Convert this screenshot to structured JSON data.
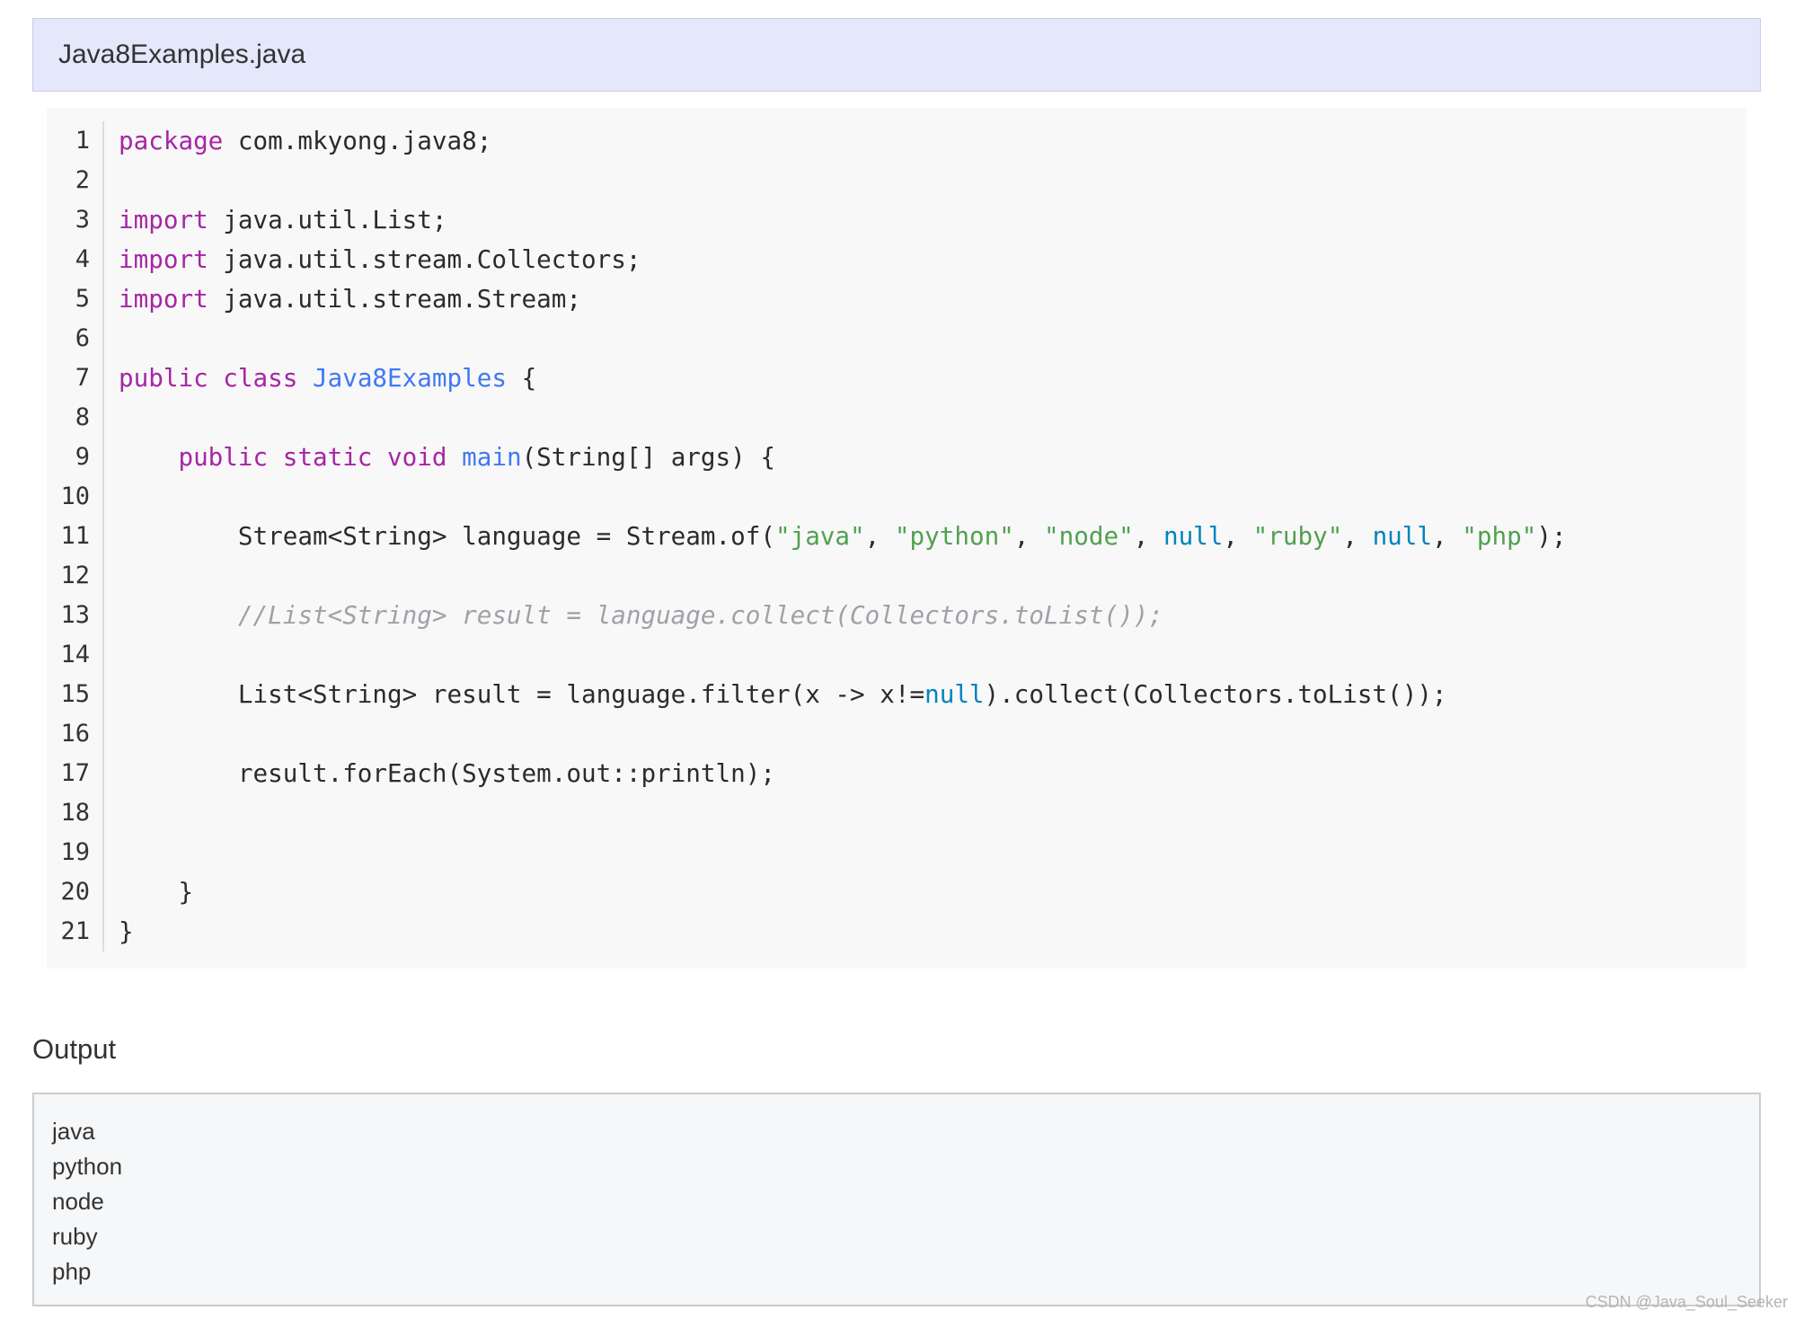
{
  "file_title": "Java8Examples.java",
  "code": {
    "language": "java",
    "line_numbers": [
      "1",
      "2",
      "3",
      "4",
      "5",
      "6",
      "7",
      "8",
      "9",
      "10",
      "11",
      "12",
      "13",
      "14",
      "15",
      "16",
      "17",
      "18",
      "19",
      "20",
      "21"
    ],
    "lines": [
      [
        {
          "t": "kw",
          "v": "package"
        },
        {
          "t": "pl",
          "v": " com.mkyong.java8;"
        }
      ],
      [],
      [
        {
          "t": "kw",
          "v": "import"
        },
        {
          "t": "pl",
          "v": " java.util.List;"
        }
      ],
      [
        {
          "t": "kw",
          "v": "import"
        },
        {
          "t": "pl",
          "v": " java.util.stream.Collectors;"
        }
      ],
      [
        {
          "t": "kw",
          "v": "import"
        },
        {
          "t": "pl",
          "v": " java.util.stream.Stream;"
        }
      ],
      [],
      [
        {
          "t": "kw",
          "v": "public class"
        },
        {
          "t": "pl",
          "v": " "
        },
        {
          "t": "fn",
          "v": "Java8Examples"
        },
        {
          "t": "pl",
          "v": " {"
        }
      ],
      [],
      [
        {
          "t": "pl",
          "v": "    "
        },
        {
          "t": "kw",
          "v": "public static void"
        },
        {
          "t": "pl",
          "v": " "
        },
        {
          "t": "fn",
          "v": "main"
        },
        {
          "t": "pl",
          "v": "(String[] args) {"
        }
      ],
      [],
      [
        {
          "t": "pl",
          "v": "        Stream<String> language = Stream.of("
        },
        {
          "t": "str",
          "v": "\"java\""
        },
        {
          "t": "pl",
          "v": ", "
        },
        {
          "t": "str",
          "v": "\"python\""
        },
        {
          "t": "pl",
          "v": ", "
        },
        {
          "t": "str",
          "v": "\"node\""
        },
        {
          "t": "pl",
          "v": ", "
        },
        {
          "t": "lit",
          "v": "null"
        },
        {
          "t": "pl",
          "v": ", "
        },
        {
          "t": "str",
          "v": "\"ruby\""
        },
        {
          "t": "pl",
          "v": ", "
        },
        {
          "t": "lit",
          "v": "null"
        },
        {
          "t": "pl",
          "v": ", "
        },
        {
          "t": "str",
          "v": "\"php\""
        },
        {
          "t": "pl",
          "v": ");"
        }
      ],
      [],
      [
        {
          "t": "pl",
          "v": "        "
        },
        {
          "t": "cm",
          "v": "//List<String> result = language.collect(Collectors.toList());"
        }
      ],
      [],
      [
        {
          "t": "pl",
          "v": "        List<String> result = language.filter(x -> x!="
        },
        {
          "t": "lit",
          "v": "null"
        },
        {
          "t": "pl",
          "v": ").collect(Collectors.toList());"
        }
      ],
      [],
      [
        {
          "t": "pl",
          "v": "        result.forEach(System.out::println);"
        }
      ],
      [],
      [],
      [
        {
          "t": "pl",
          "v": "    }"
        }
      ],
      [
        {
          "t": "pl",
          "v": "}"
        }
      ]
    ]
  },
  "output": {
    "heading": "Output",
    "lines": [
      "java",
      "python",
      "node",
      "ruby",
      "php"
    ]
  },
  "watermark": "CSDN @Java_Soul_Seeker"
}
